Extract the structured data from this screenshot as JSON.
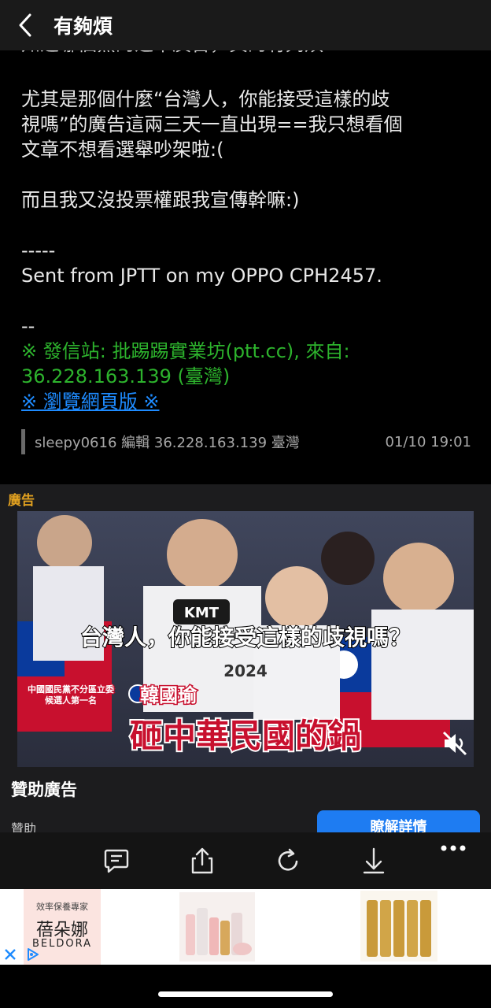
{
  "header": {
    "title": "有夠煩"
  },
  "article": {
    "cut_line": "知道哪個黨的選舉廣告，真的有夠煩==",
    "paragraph1": [
      "尤其是那個什麼“台灣人，你能接受這樣的歧",
      "視嗎”的廣告這兩三天一直出現==我只想看個",
      "文章不想看選舉吵架啦:("
    ],
    "paragraph2": "而且我又沒投票權跟我宣傳幹嘛:)",
    "sig_divider": "-----",
    "sig_text": "Sent from JPTT on my OPPO CPH2457.",
    "footer_divider": "--",
    "origin_line1": "※ 發信站: 批踢踢實業坊(ptt.cc), 來自:",
    "origin_line2": "36.228.163.139 (臺灣)",
    "web_link": "※ 瀏覽網頁版 ※"
  },
  "edit": {
    "user": "sleepy0616",
    "action": "編輯",
    "ip": "36.228.163.139",
    "region": "臺灣",
    "time": "01/10 19:01"
  },
  "ad": {
    "tag": "廣告",
    "video": {
      "caption": "台灣人，你能接受這樣的歧視嗎？",
      "badge": "KMT",
      "small_text1": "中國國民黨不分區立委",
      "small_text2": "候選人第一名",
      "name": "韓國瑜",
      "headline": "砸中華民國的鍋",
      "number": "2024",
      "mute_icon": "speaker-muted-icon"
    },
    "sponsor_title": "贊助廣告",
    "sponsor_sub": "贊助",
    "learn_more": "瞭解詳情"
  },
  "toolbar": {
    "icons": [
      "comment-icon",
      "share-icon",
      "refresh-icon",
      "download-icon",
      "more-icon"
    ]
  },
  "banner": {
    "brand_tagline": "效率保養專家",
    "brand_cn": "蓓朵娜",
    "brand_en": "BELDORA",
    "close_icon": "close-icon",
    "adchoices_icon": "adchoices-icon"
  },
  "colors": {
    "accent_green": "#2db32d",
    "link_blue": "#1e8bff",
    "ad_tag": "#e0a020",
    "button_blue": "#1e7cf2"
  }
}
